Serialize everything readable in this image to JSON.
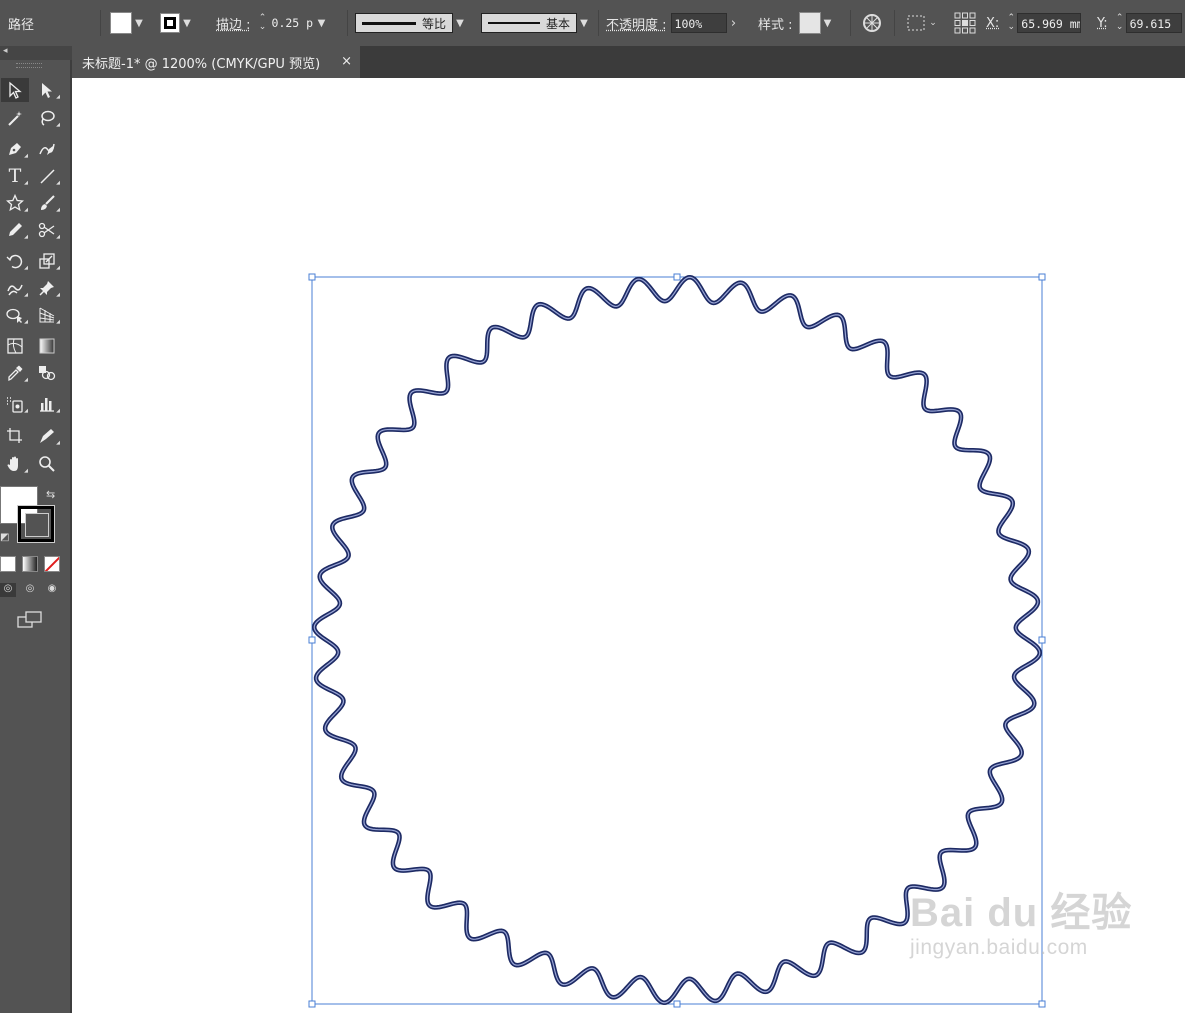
{
  "control_bar": {
    "object_type": "路径",
    "stroke_label": "描边 :",
    "stroke_weight": "0.25 p",
    "profile_label": "等比",
    "brush_label": "基本",
    "opacity_label": "不透明度 :",
    "opacity_value": "100%",
    "style_label": "样式 :",
    "x_label": "X:",
    "x_value": "65.969 mm",
    "y_label": "Y:",
    "y_value": "69.615"
  },
  "document_tab": {
    "title": "未标题-1* @ 1200% (CMYK/GPU 预览)",
    "close": "×"
  },
  "toolbox": {
    "tools": [
      "selection-tool",
      "direct-selection-tool",
      "magic-wand-tool",
      "lasso-tool",
      "pen-tool",
      "curvature-tool",
      "type-tool",
      "line-segment-tool",
      "star-tool",
      "paintbrush-tool",
      "pencil-tool",
      "scissors-tool",
      "rotate-tool",
      "scale-tool",
      "warp-tool",
      "puppet-warp-tool",
      "shape-builder-tool",
      "perspective-grid-tool",
      "mesh-tool",
      "gradient-tool",
      "eyedropper-tool",
      "blend-tool",
      "symbol-sprayer-tool",
      "column-graph-tool",
      "artboard-tool",
      "slice-tool",
      "hand-tool",
      "zoom-tool"
    ],
    "fill_color": "#ffffff",
    "stroke_color": "#000000"
  },
  "artwork": {
    "shape": "wavy-circle",
    "wave_count": 44,
    "stroke_color": "#1d2a64",
    "inner_color": "#9aa6d6",
    "selection_color": "#4a7fd4"
  },
  "watermark": {
    "main": "Bai du 经验",
    "sub": "jingyan.baidu.com"
  }
}
